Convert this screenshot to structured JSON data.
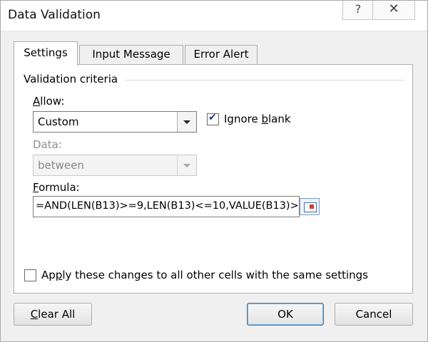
{
  "window": {
    "title": "Data Validation",
    "help_label": "?",
    "close_label": "✕"
  },
  "tabs": [
    {
      "label": "Settings",
      "active": true
    },
    {
      "label": "Input Message",
      "active": false
    },
    {
      "label": "Error Alert",
      "active": false
    }
  ],
  "settings": {
    "group_label": "Validation criteria",
    "allow": {
      "label_u": "A",
      "label_rest": "llow:",
      "value": "Custom"
    },
    "ignore_blank": {
      "label_pre": "Ignore ",
      "label_u": "b",
      "label_post": "lank",
      "checked": true
    },
    "data": {
      "label": "Data:",
      "value": "between",
      "disabled": true
    },
    "formula": {
      "label_u": "F",
      "label_rest": "ormula:",
      "value": "=AND(LEN(B13)>=9,LEN(B13)<=10,VALUE(B13)>"
    },
    "apply_all": {
      "label_pre": "Ap",
      "label_u": "p",
      "label_post": "ly these changes to all other cells with the same settings",
      "checked": false
    }
  },
  "buttons": {
    "clear_u": "C",
    "clear_rest": "lear All",
    "ok": "OK",
    "cancel": "Cancel"
  },
  "icons": {
    "help": "help-icon",
    "close": "close-icon",
    "range_select": "collapse-dialog-icon",
    "dropdown": "chevron-down-icon"
  }
}
